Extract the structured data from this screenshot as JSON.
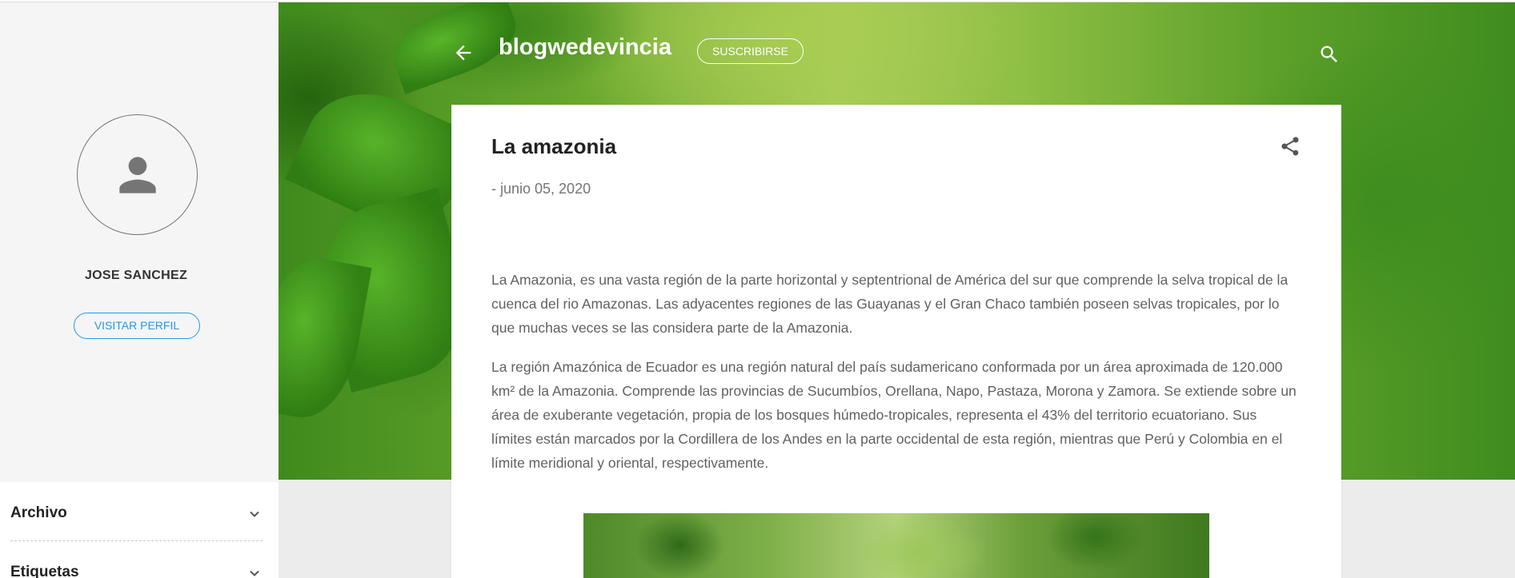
{
  "colors": {
    "accent": "#2196f3",
    "sidebar_bg": "#f5f5f5",
    "page_bg": "#ececec",
    "text": "#616161"
  },
  "header": {
    "blog_title": "blogwedevincia",
    "subscribe_label": "SUSCRIBIRSE",
    "back_icon": "arrow-back-icon",
    "search_icon": "search-icon"
  },
  "profile": {
    "name": "JOSE SANCHEZ",
    "visit_label": "VISITAR PERFIL",
    "avatar_icon": "person-icon"
  },
  "sidebar": {
    "widgets": [
      {
        "title": "Archivo",
        "icon": "chevron-down-icon"
      },
      {
        "title": "Etiquetas",
        "icon": "chevron-down-icon"
      }
    ]
  },
  "post": {
    "title": "La amazonia",
    "date": "- junio 05, 2020",
    "share_icon": "share-icon",
    "paragraphs": [
      "La Amazonia, es una vasta región de la parte horizontal y septentrional de América del sur  que comprende la selva tropical de la  cuenca del rio Amazonas. Las adyacentes regiones de las Guayanas  y el Gran Chaco también poseen selvas tropicales, por lo que muchas veces se las considera parte de la Amazonia.",
      "La región Amazónica de Ecuador es una región natural del país sudamericano conformada por un área aproximada de 120.000 km² de la Amazonia. Comprende las provincias de Sucumbíos, Orellana, Napo, Pastaza, Morona y Zamora. Se extiende sobre un área de exuberante vegetación, propia de los bosques húmedo-tropicales, representa el 43% del territorio ecuatoriano. Sus límites están marcados por la Cordillera de los Andes en la parte occidental de esta región, mientras que Perú y Colombia en el límite meridional y oriental, respectivamente."
    ]
  }
}
